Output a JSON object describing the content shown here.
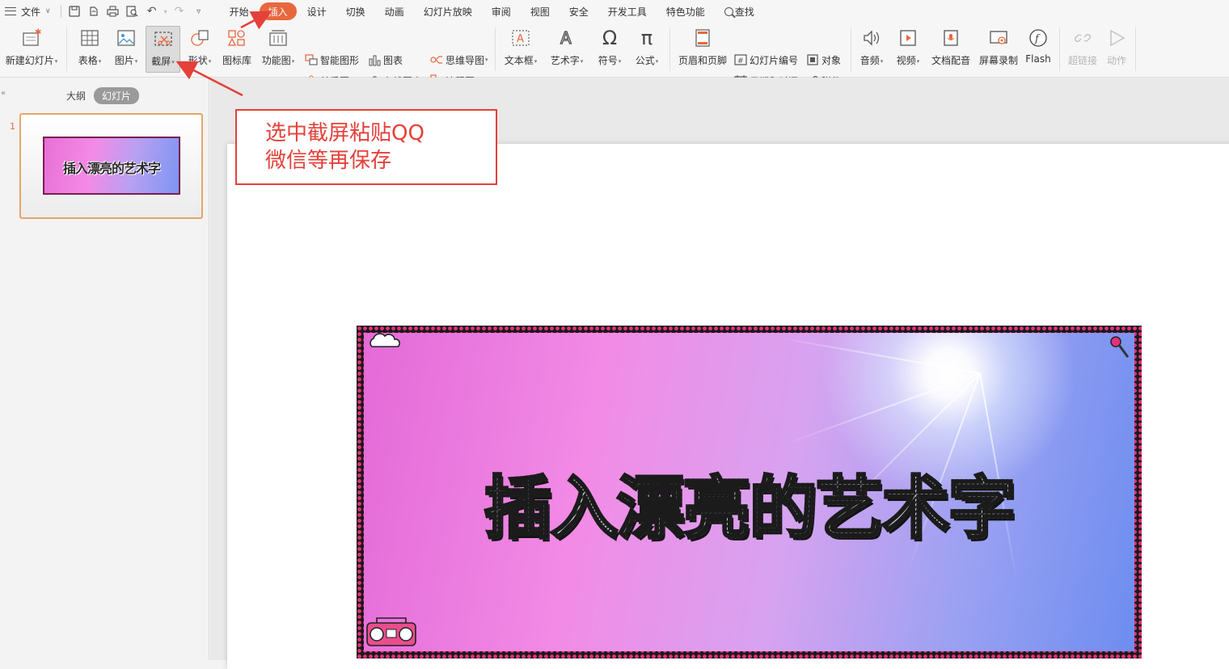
{
  "menubar": {
    "file_label": "文件",
    "tabs": [
      "开始",
      "插入",
      "设计",
      "切换",
      "动画",
      "幻灯片放映",
      "审阅",
      "视图",
      "安全",
      "开发工具",
      "特色功能"
    ],
    "active_tab": "插入",
    "search_label": "查找"
  },
  "ribbon": {
    "new_slide": "新建幻灯片",
    "table": "表格",
    "picture": "图片",
    "screenshot": "截屏",
    "shape": "形状",
    "icon_lib": "图标库",
    "func_chart": "功能图",
    "smart_art": "智能图形",
    "chart": "图表",
    "mind_map": "思维导图",
    "relation": "关系图",
    "online_chart": "在线图表",
    "flowchart": "流程图",
    "textbox": "文本框",
    "wordart": "艺术字",
    "symbol": "符号",
    "formula": "公式",
    "header_footer": "页眉和页脚",
    "slide_number": "幻灯片编号",
    "object": "对象",
    "datetime": "日期和时间",
    "attachment": "附件",
    "audio": "音频",
    "video": "视频",
    "doc_voice": "文档配音",
    "screen_record": "屏幕录制",
    "flash": "Flash",
    "hyperlink": "超链接",
    "action": "动作"
  },
  "left_panel": {
    "tab_outline": "大纲",
    "tab_slides": "幻灯片",
    "slide_number": "1",
    "thumb_title": "插入漂亮的艺术字"
  },
  "slide": {
    "title": "插入漂亮的艺术字"
  },
  "annotation": {
    "line1": "选中截屏粘贴QQ",
    "line2": "微信等再保存",
    "color": "#e3413a"
  },
  "colors": {
    "accent": "#e8673f",
    "border_pink": "#e2317c"
  }
}
